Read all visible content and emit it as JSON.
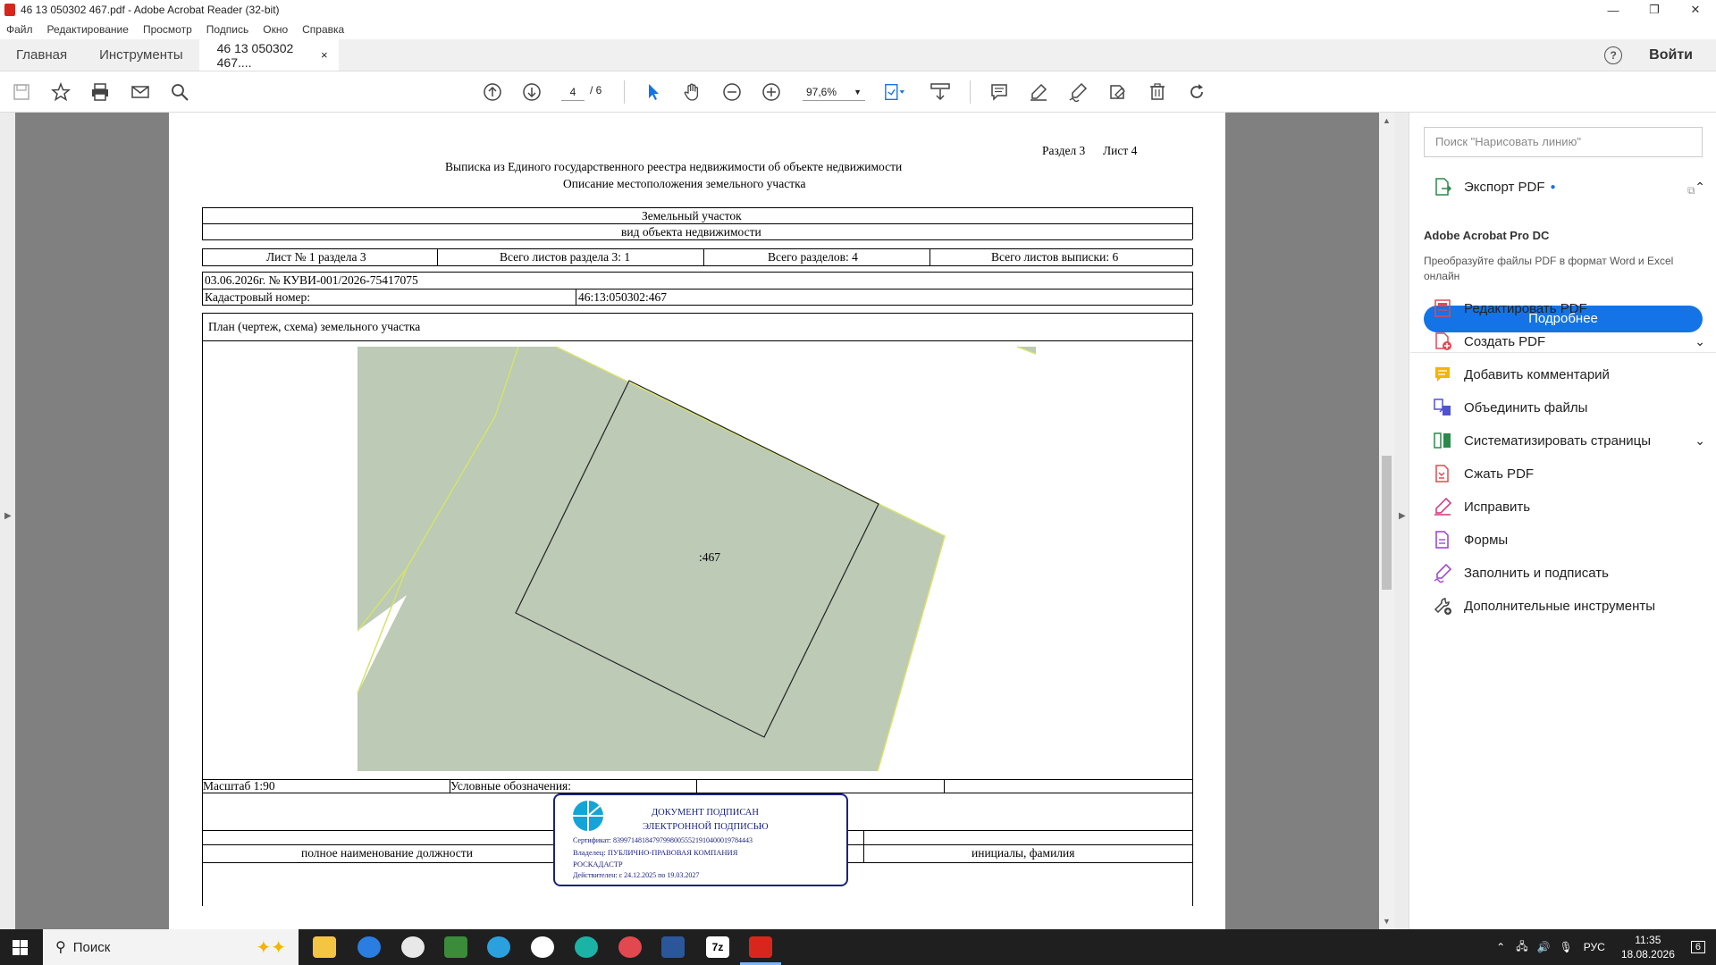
{
  "window": {
    "title": "46 13 050302 467.pdf - Adobe Acrobat Reader (32-bit)",
    "controls": [
      "—",
      "❐",
      "✕"
    ]
  },
  "menu": [
    "Файл",
    "Редактирование",
    "Просмотр",
    "Подпись",
    "Окно",
    "Справка"
  ],
  "tabs": {
    "home": "Главная",
    "tools": "Инструменты",
    "doc": "46 13 050302 467....",
    "close": "×",
    "help": "?",
    "login": "Войти"
  },
  "toolbar": {
    "page_current": "4",
    "page_total": "/ 6",
    "zoom": "97,6%"
  },
  "document": {
    "header_section": "Раздел 3",
    "header_sheet": "Лист 4",
    "title1": "Выписка из Единого государственного реестра недвижимости об объекте недвижимости",
    "title2": "Описание местоположения земельного участка",
    "object_type": "Земельный участок",
    "object_type_caption": "вид объекта недвижимости",
    "sheet_info": "Лист № 1 раздела 3",
    "total_sheets_section": "Всего листов раздела 3: 1",
    "total_sections": "Всего разделов: 4",
    "total_sheets": "Всего листов выписки: 6",
    "date_number": "03.06.2026г. № КУВИ-001/2026-75417075",
    "cadastral_label": "Кадастровый номер:",
    "cadastral_value": "46:13:050302:467",
    "plan_title": "План (чертеж, схема) земельного участка",
    "parcel_label": ":467",
    "scale": "Масштаб 1:90",
    "legend": "Условные обозначения:",
    "position_caption": "полное наименование должности",
    "name_caption": "инициалы, фамилия",
    "stamp": {
      "line1": "ДОКУМЕНТ ПОДПИСАН",
      "line2": "ЭЛЕКТРОННОЙ ПОДПИСЬЮ",
      "cert": "Сертификат: 839971481847979980055521910400019784443",
      "owner": "Владелец: ПУБЛИЧНО-ПРАВОВАЯ КОМПАНИЯ",
      "owner2": "РОСКАДАСТР",
      "valid": "Действителен: с 24.12.2025 по 19.03.2027"
    }
  },
  "right_panel": {
    "search_placeholder": "Поиск \"Нарисовать линию\"",
    "export": "Экспорт PDF",
    "promo_title": "Adobe Acrobat Pro DC",
    "promo_text": "Преобразуйте файлы PDF в формат Word и Excel онлайн",
    "promo_button": "Подробнее",
    "tools": [
      "Редактировать PDF",
      "Создать PDF",
      "Добавить комментарий",
      "Объединить файлы",
      "Систематизировать страницы",
      "Сжать PDF",
      "Исправить",
      "Формы",
      "Заполнить и подписать",
      "Дополнительные инструменты"
    ]
  },
  "taskbar": {
    "search": "Поиск",
    "lang": "РУС",
    "time": "11:35",
    "date": "18.08.2026",
    "notif": "6"
  },
  "colors": {
    "parcel_fill": "#bccab6",
    "accent_blue": "#1473e6",
    "stamp_border": "#1a237e"
  }
}
